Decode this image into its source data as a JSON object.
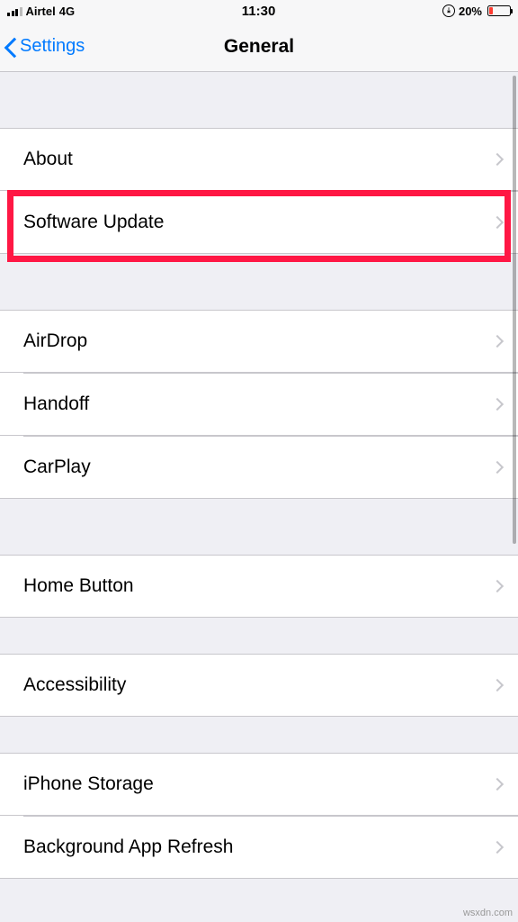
{
  "statusBar": {
    "carrier": "Airtel",
    "network": "4G",
    "time": "11:30",
    "batteryPercent": "20%"
  },
  "nav": {
    "back": "Settings",
    "title": "General"
  },
  "groups": [
    {
      "items": [
        {
          "id": "about",
          "label": "About"
        },
        {
          "id": "software-update",
          "label": "Software Update"
        }
      ]
    },
    {
      "items": [
        {
          "id": "airdrop",
          "label": "AirDrop"
        },
        {
          "id": "handoff",
          "label": "Handoff"
        },
        {
          "id": "carplay",
          "label": "CarPlay"
        }
      ]
    },
    {
      "items": [
        {
          "id": "home-button",
          "label": "Home Button"
        }
      ]
    },
    {
      "items": [
        {
          "id": "accessibility",
          "label": "Accessibility"
        }
      ]
    },
    {
      "items": [
        {
          "id": "iphone-storage",
          "label": "iPhone Storage"
        },
        {
          "id": "background-app-refresh",
          "label": "Background App Refresh"
        }
      ]
    }
  ],
  "watermark": "wsxdn.com"
}
